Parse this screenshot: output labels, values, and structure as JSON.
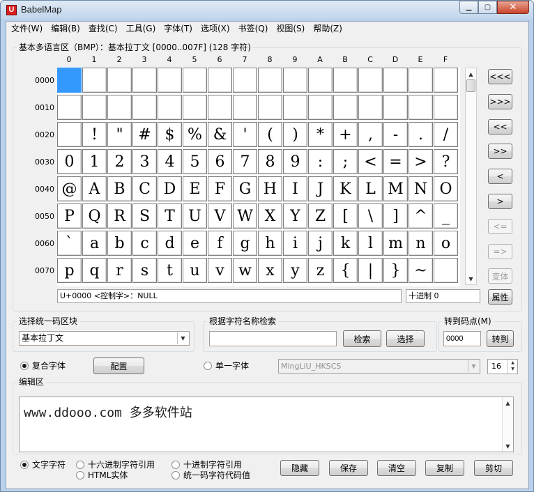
{
  "window": {
    "title": "BabelMap",
    "icon_letter": "U"
  },
  "menu": [
    "文件(W)",
    "编辑(B)",
    "查找(C)",
    "工具(G)",
    "字体(T)",
    "选项(X)",
    "书签(Q)",
    "视图(S)",
    "帮助(Z)"
  ],
  "charmap": {
    "group_label": "基本多语言区（BMP）：基本拉丁文 [0000..007F] (128 字符)",
    "col_headers": [
      "0",
      "1",
      "2",
      "3",
      "4",
      "5",
      "6",
      "7",
      "8",
      "9",
      "A",
      "B",
      "C",
      "D",
      "E",
      "F"
    ],
    "row_headers": [
      "0000",
      "0010",
      "0020",
      "0030",
      "0040",
      "0050",
      "0060",
      "0070"
    ],
    "rows": [
      [
        "",
        "",
        "",
        "",
        "",
        "",
        "",
        "",
        "",
        "",
        "",
        "",
        "",
        "",
        "",
        ""
      ],
      [
        "",
        "",
        "",
        "",
        "",
        "",
        "",
        "",
        "",
        "",
        "",
        "",
        "",
        "",
        "",
        ""
      ],
      [
        "",
        " !",
        "\"",
        "#",
        "$",
        "%",
        "&",
        "'",
        "(",
        ")",
        "*",
        "+",
        ",",
        "-",
        ".",
        "/"
      ],
      [
        "0",
        "1",
        "2",
        "3",
        "4",
        "5",
        "6",
        "7",
        "8",
        "9",
        ":",
        ";",
        "<",
        "=",
        ">",
        "?"
      ],
      [
        "@",
        "A",
        "B",
        "C",
        "D",
        "E",
        "F",
        "G",
        "H",
        "I",
        "J",
        "K",
        "L",
        "M",
        "N",
        "O"
      ],
      [
        "P",
        "Q",
        "R",
        "S",
        "T",
        "U",
        "V",
        "W",
        "X",
        "Y",
        "Z",
        "[",
        "\\",
        "]",
        "^",
        "_"
      ],
      [
        "`",
        "a",
        "b",
        "c",
        "d",
        "e",
        "f",
        "g",
        "h",
        "i",
        "j",
        "k",
        "l",
        "m",
        "n",
        "o"
      ],
      [
        "p",
        "q",
        "r",
        "s",
        "t",
        "u",
        "v",
        "w",
        "x",
        "y",
        "z",
        "{",
        "|",
        "}",
        "~",
        ""
      ]
    ],
    "selected": "0000",
    "status_char": "U+0000 <控制字>：NULL",
    "status_dec": "十进制 0"
  },
  "nav_buttons": [
    "<<<",
    ">>>",
    "<<",
    ">>",
    "<",
    ">",
    "<=",
    "=>",
    "变体"
  ],
  "properties_button": "属性",
  "block_select": {
    "label": "选择统一码区块",
    "value": "基本拉丁文"
  },
  "name_search": {
    "label": "根据字符名称检索",
    "value": "",
    "search_button": "检索",
    "select_button": "选择"
  },
  "goto": {
    "label": "转到码点(M)",
    "value": "0000",
    "button": "转到"
  },
  "font": {
    "composite_label": "复合字体",
    "config_button": "配置",
    "single_label": "单一字体",
    "font_name": "MingLiU_HKSCS",
    "size": "16"
  },
  "edit": {
    "label": "编辑区",
    "text": "www.ddooo.com 多多软件站"
  },
  "output_options": {
    "text_chars": "文字字符",
    "hex_ref": "十六进制字符引用",
    "dec_ref": "十进制字符引用",
    "html_entity": "HTML实体",
    "unicode_value": "统一码字符代码值"
  },
  "bottom_buttons": {
    "hide": "隐藏",
    "save": "保存",
    "clear": "清空",
    "copy": "复制",
    "cut": "剪切"
  }
}
